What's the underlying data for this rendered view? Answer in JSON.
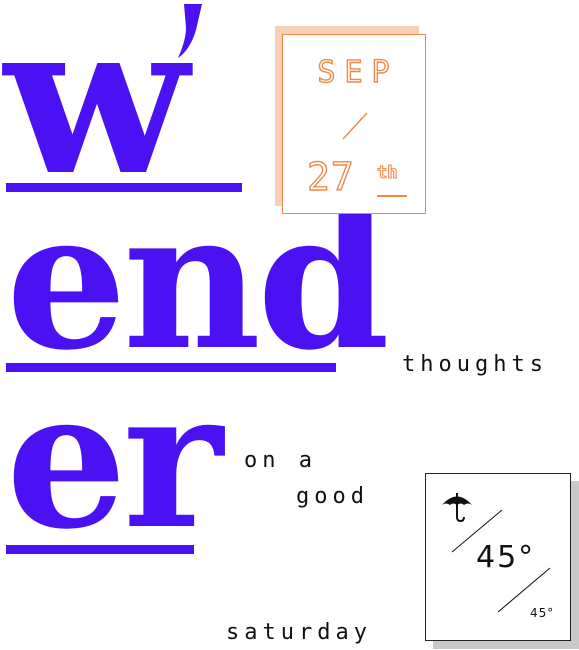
{
  "title": {
    "line1": "w",
    "line2": "end",
    "line3": "er",
    "accent_color": "#4a12f2"
  },
  "date": {
    "month": "SEP",
    "day": "27",
    "suffix": "th",
    "accent_color": "#f08a4b"
  },
  "phrases": {
    "thoughts": "thoughts",
    "on_a": "on a",
    "good": "good",
    "saturday": "saturday"
  },
  "weather": {
    "icon": "umbrella-icon",
    "high": "45°",
    "low": "45°"
  }
}
